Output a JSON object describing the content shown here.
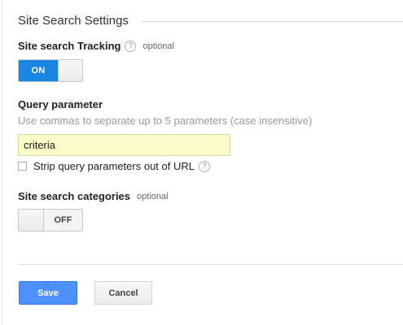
{
  "section": {
    "title": "Site Search Settings"
  },
  "tracking": {
    "label": "Site search Tracking",
    "help": "?",
    "optional": "optional",
    "toggle_state": "ON"
  },
  "query_parameter": {
    "label": "Query parameter",
    "hint": "Use commas to separate up to 5 parameters (case insensitive)",
    "value": "criteria",
    "strip_checkbox_label": "Strip query parameters out of URL",
    "strip_checked": false,
    "help": "?"
  },
  "categories": {
    "label": "Site search categories",
    "optional": "optional",
    "toggle_state": "OFF"
  },
  "buttons": {
    "save": "Save",
    "cancel": "Cancel"
  },
  "colors": {
    "accent": "#1a86e3",
    "save_button": "#4d90fe",
    "input_highlight": "#fafbc8"
  }
}
